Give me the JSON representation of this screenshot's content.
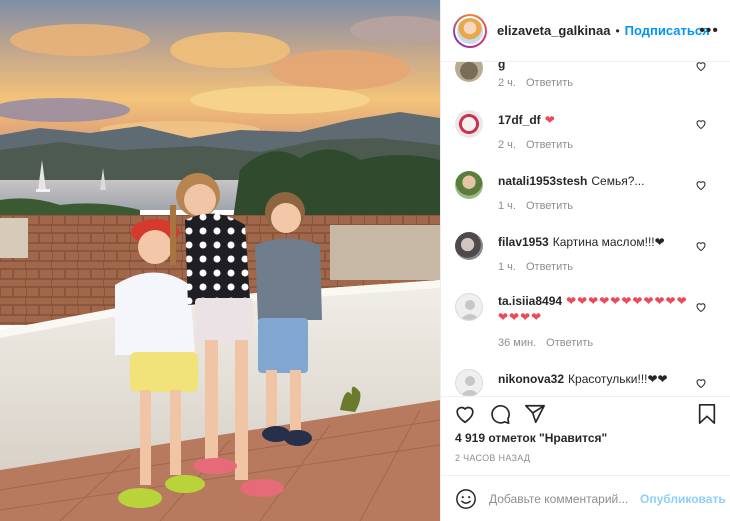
{
  "post": {
    "username": "elizaveta_galkinaa",
    "separator": "•",
    "follow_label": "Подписаться",
    "more_icon": "more-horizontal-icon"
  },
  "comments": [
    {
      "user": "g",
      "text": "",
      "time": "2 ч.",
      "reply_label": "Ответить",
      "partial": true
    },
    {
      "user": "17df_df",
      "text": "❤",
      "time": "2 ч.",
      "reply_label": "Ответить"
    },
    {
      "user": "natali1953stesh",
      "text": "Семья?...",
      "time": "1 ч.",
      "reply_label": "Ответить"
    },
    {
      "user": "filav1953",
      "text": "Картина маслом!!!❤",
      "time": "1 ч.",
      "reply_label": "Ответить"
    },
    {
      "user": "ta.isiia8494",
      "text": "❤❤❤❤❤❤❤❤❤❤❤❤❤❤❤",
      "time": "36 мин.",
      "reply_label": "Ответить"
    },
    {
      "user": "nikonova32",
      "text": "Красотульки!!!❤❤",
      "time": "",
      "reply_label": "",
      "partial": true
    }
  ],
  "actions": {
    "like_icon": "heart-icon",
    "comment_icon": "comment-icon",
    "share_icon": "share-icon",
    "save_icon": "bookmark-icon"
  },
  "likes_text": "4 919 отметок \"Нравится\"",
  "date_text": "2 ЧАСОВ НАЗАД",
  "add_comment": {
    "emoji_icon": "smiley-icon",
    "placeholder": "Добавьте комментарий...",
    "publish_label": "Опубликовать"
  },
  "colors": {
    "accent": "#0095f6",
    "heart": "#ed4956",
    "muted": "#8e8e8e",
    "text": "#262626"
  }
}
